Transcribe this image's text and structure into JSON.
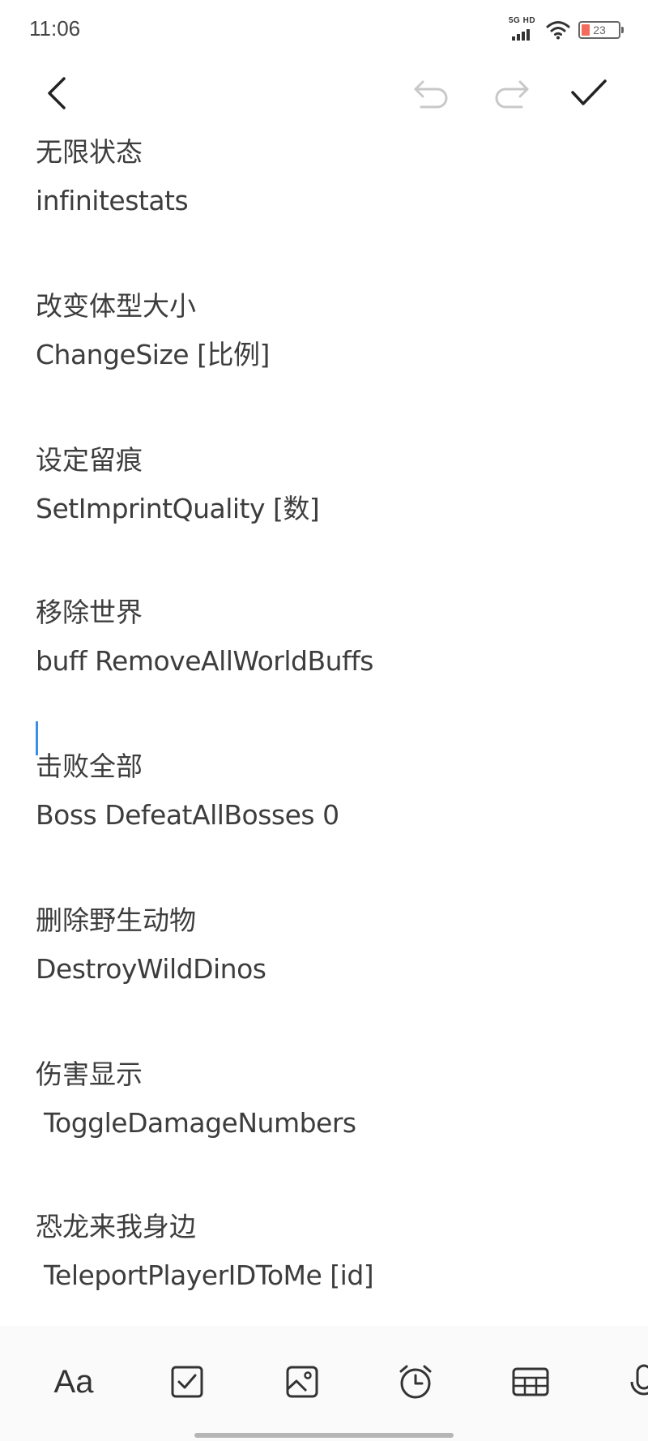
{
  "status_bar": {
    "time": "11:06",
    "network_label": "5G HD",
    "battery_level": "23",
    "battery_color": "#f26b5b"
  },
  "toolbar": {
    "back_icon": "chevron-left-icon",
    "undo_icon": "undo-icon",
    "redo_icon": "redo-icon",
    "done_icon": "check-icon"
  },
  "note": {
    "entries": [
      {
        "title": "无限状态",
        "command": "infinitestats"
      },
      {
        "title": "改变体型大小",
        "command": "ChangeSize [比例]"
      },
      {
        "title": "设定留痕",
        "command": "SetImprintQuality [数]"
      },
      {
        "title": "移除世界",
        "command": "buff RemoveAllWorldBuffs"
      },
      {
        "title": "击败全部",
        "command": "Boss DefeatAllBosses 0"
      },
      {
        "title": "删除野生动物",
        "command": "DestroyWildDinos"
      },
      {
        "title": "伤害显示",
        "command": " ToggleDamageNumbers"
      },
      {
        "title": "恐龙来我身边",
        "command": " TeleportPlayerIDToMe [id]"
      }
    ],
    "cursor_color": "#3a8ee6"
  },
  "bottom_bar": {
    "text_format_label": "Aa",
    "icons": [
      "checkbox-icon",
      "image-icon",
      "alarm-icon",
      "table-icon",
      "microphone-icon"
    ]
  }
}
